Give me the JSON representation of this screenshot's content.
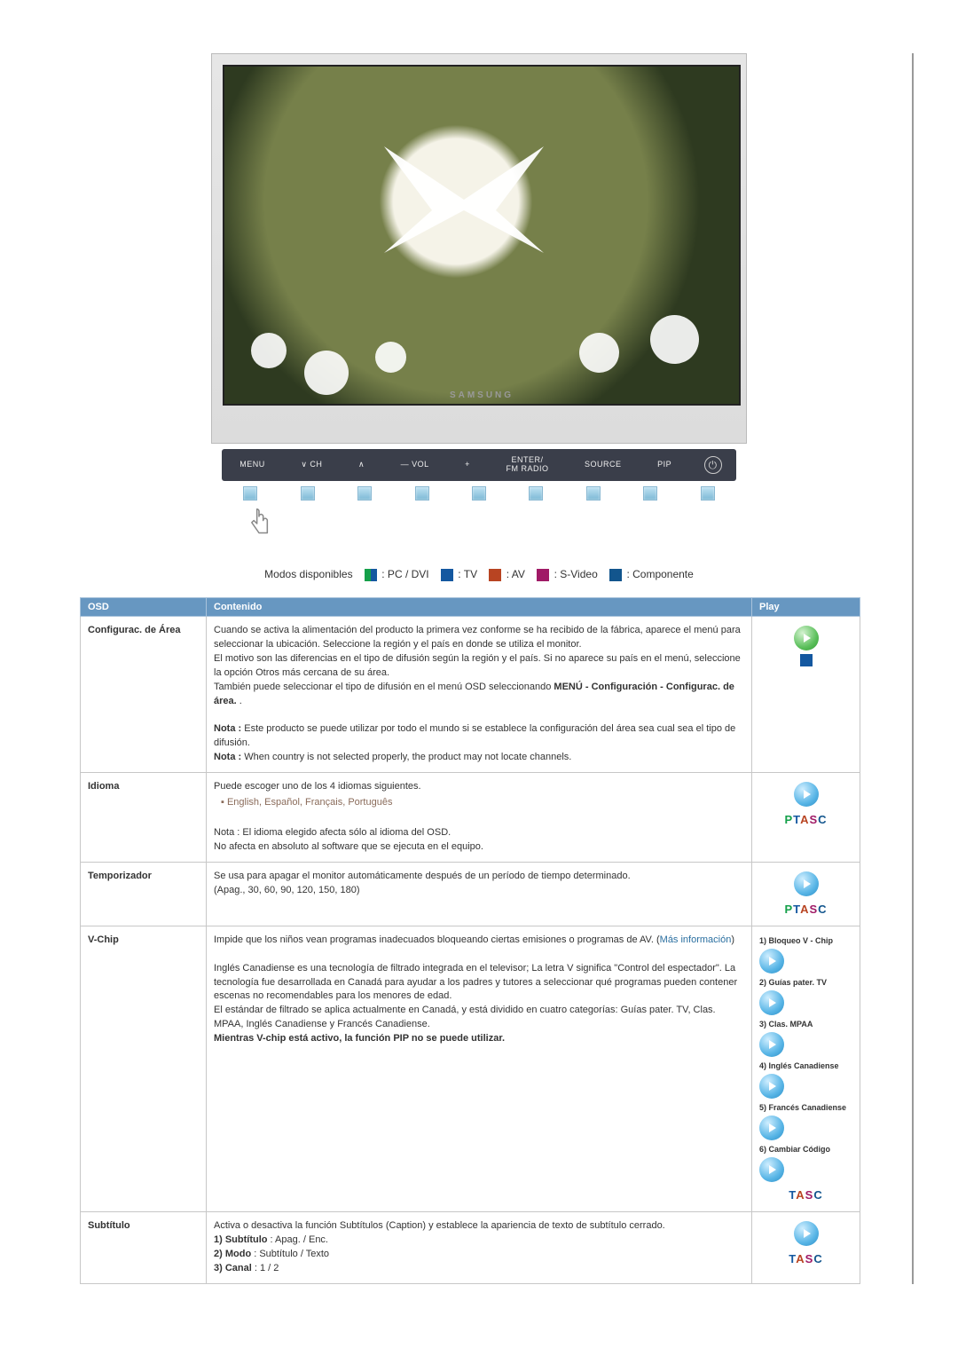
{
  "hero": {
    "brand": "SAMSUNG",
    "controls": {
      "menu": "MENU",
      "ch_down": "∨  CH",
      "ch_up": "∧",
      "vol_minus": "—  VOL",
      "vol_plus": "+",
      "enter": "ENTER/\nFM RADIO",
      "source": "SOURCE",
      "pip": "PIP"
    }
  },
  "modes": {
    "label": "Modos disponibles",
    "p": ": PC / DVI",
    "t": ": TV",
    "a": ": AV",
    "s": ": S-Video",
    "c": ": Componente"
  },
  "table": {
    "headers": {
      "osd": "OSD",
      "contenido": "Contenido",
      "play": "Play"
    },
    "rows": {
      "configurac": {
        "osd": "Configurac. de Área",
        "body1": "Cuando se activa la alimentación del producto la primera vez conforme se ha recibido de la fábrica, aparece el menú para seleccionar la ubicación. Seleccione la región y el país en donde se utiliza el monitor.",
        "body2": "El motivo son las diferencias en el tipo de difusión según la región y el país. Si no aparece su país en el menú, seleccione la opción Otros más cercana de su área.",
        "body3": "También puede seleccionar el tipo de difusión en el menú OSD seleccionando ",
        "body3_bold": "MENÚ - Configuración - Configurac. de área.",
        "body3_tail": ".",
        "nota1_label": "Nota : ",
        "nota1": "Este producto se puede utilizar por todo el mundo si se establece la configuración del área sea cual sea el tipo de difusión.",
        "nota2_label": "Nota : ",
        "nota2": "When country is not selected properly, the product may not locate channels."
      },
      "idioma": {
        "osd": "Idioma",
        "body1": "Puede escoger uno de los 4 idiomas siguientes.",
        "langs": "English, Español, Français, Português",
        "nota": "Nota : El idioma elegido afecta sólo al idioma del OSD.",
        "nota_tail": "No afecta en absoluto al software que se ejecuta en el equipo."
      },
      "temporizador": {
        "osd": "Temporizador",
        "body1": "Se usa para apagar el monitor automáticamente después de un período de tiempo determinado.",
        "values": "(Apag., 30, 60, 90, 120, 150, 180)"
      },
      "vchip": {
        "osd": "V-Chip",
        "body1": "Impide que los niños vean programas inadecuados bloqueando ciertas emisiones o programas de AV. (",
        "mas_info": "Más información",
        "body1_tail": ")",
        "body2": "Inglés Canadiense es una tecnología de filtrado integrada en el televisor; La letra V significa \"Control del espectador\". La tecnología fue desarrollada en Canadá para ayudar a los padres y tutores a seleccionar qué programas pueden contener escenas no recomendables para los menores de edad.",
        "body3": "El estándar de filtrado se aplica actualmente en Canadá, y está dividido en cuatro categorías: Guías pater. TV, Clas. MPAA, Inglés Canadiense y Francés Canadiense.",
        "bold_note": "Mientras V-chip está activo, la función PIP no se puede utilizar.",
        "play_items": {
          "i1": "1) Bloqueo V - Chip",
          "i2": "2) Guías pater. TV",
          "i3": "3) Clas. MPAA",
          "i4": "4) Inglés Canadiense",
          "i5": "5) Francés Canadiense",
          "i6": "6) Cambiar Código"
        }
      },
      "subtitulo": {
        "osd": "Subtítulo",
        "body1": "Activa o desactiva la función Subtítulos (Caption) y establece la apariencia de texto de subtítulo cerrado.",
        "l1_label": "1) Subtítulo",
        "l1_val": " : Apag. / Enc.",
        "l2_label": "2) Modo",
        "l2_val": " : Subtítulo / Texto",
        "l3_label": "3) Canal",
        "l3_val": " : 1 / 2"
      }
    }
  }
}
